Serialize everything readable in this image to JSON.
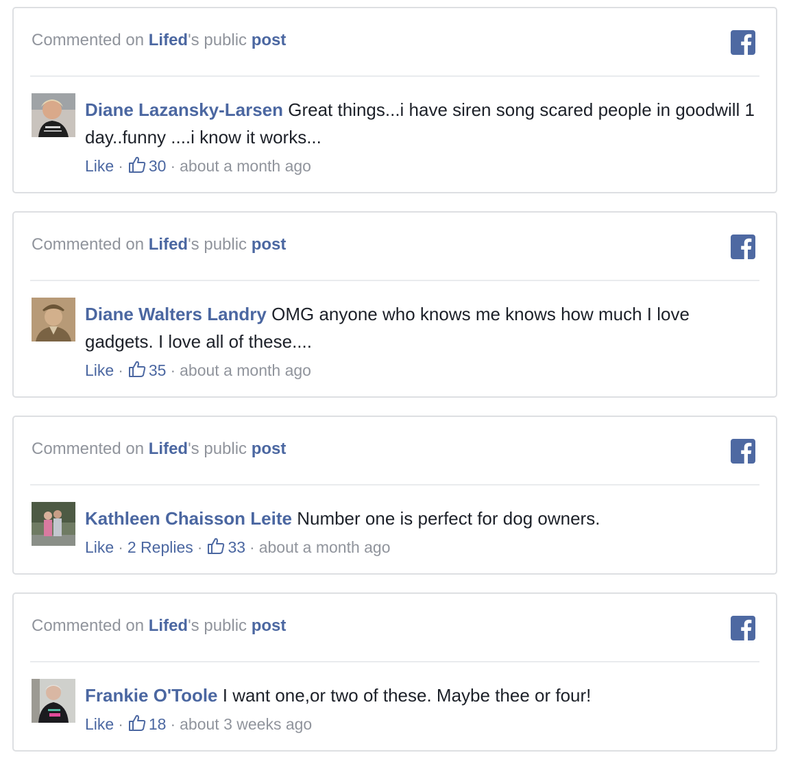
{
  "header": {
    "prefix": "Commented on ",
    "page_name": "Lifed",
    "middle": "'s public ",
    "post_link": "post"
  },
  "actions": {
    "like": "Like",
    "separator": "·"
  },
  "icons": {
    "platform": "facebook-icon",
    "like": "thumbs-up-icon"
  },
  "colors": {
    "link": "#4b67a1",
    "muted": "#90949c",
    "text": "#1d2129",
    "facebook": "#4e69a2",
    "border": "#dddfe2"
  },
  "comments": [
    {
      "author": "Diane Lazansky-Larsen",
      "text": "Great things...i have siren song scared people in goodwill 1 day..funny ....i know it works...",
      "replies": "",
      "likes": "30",
      "time": "about a month ago"
    },
    {
      "author": "Diane Walters Landry",
      "text": "OMG anyone who knows me knows how much I love gadgets. I love all of these....",
      "replies": "",
      "likes": "35",
      "time": "about a month ago"
    },
    {
      "author": "Kathleen Chaisson Leite",
      "text": "Number one is perfect for dog owners.",
      "replies": "2 Replies",
      "likes": "33",
      "time": "about a month ago"
    },
    {
      "author": "Frankie O'Toole",
      "text": "I want one,or two of these. Maybe thee or four!",
      "replies": "",
      "likes": "18",
      "time": "about 3 weeks ago"
    }
  ]
}
